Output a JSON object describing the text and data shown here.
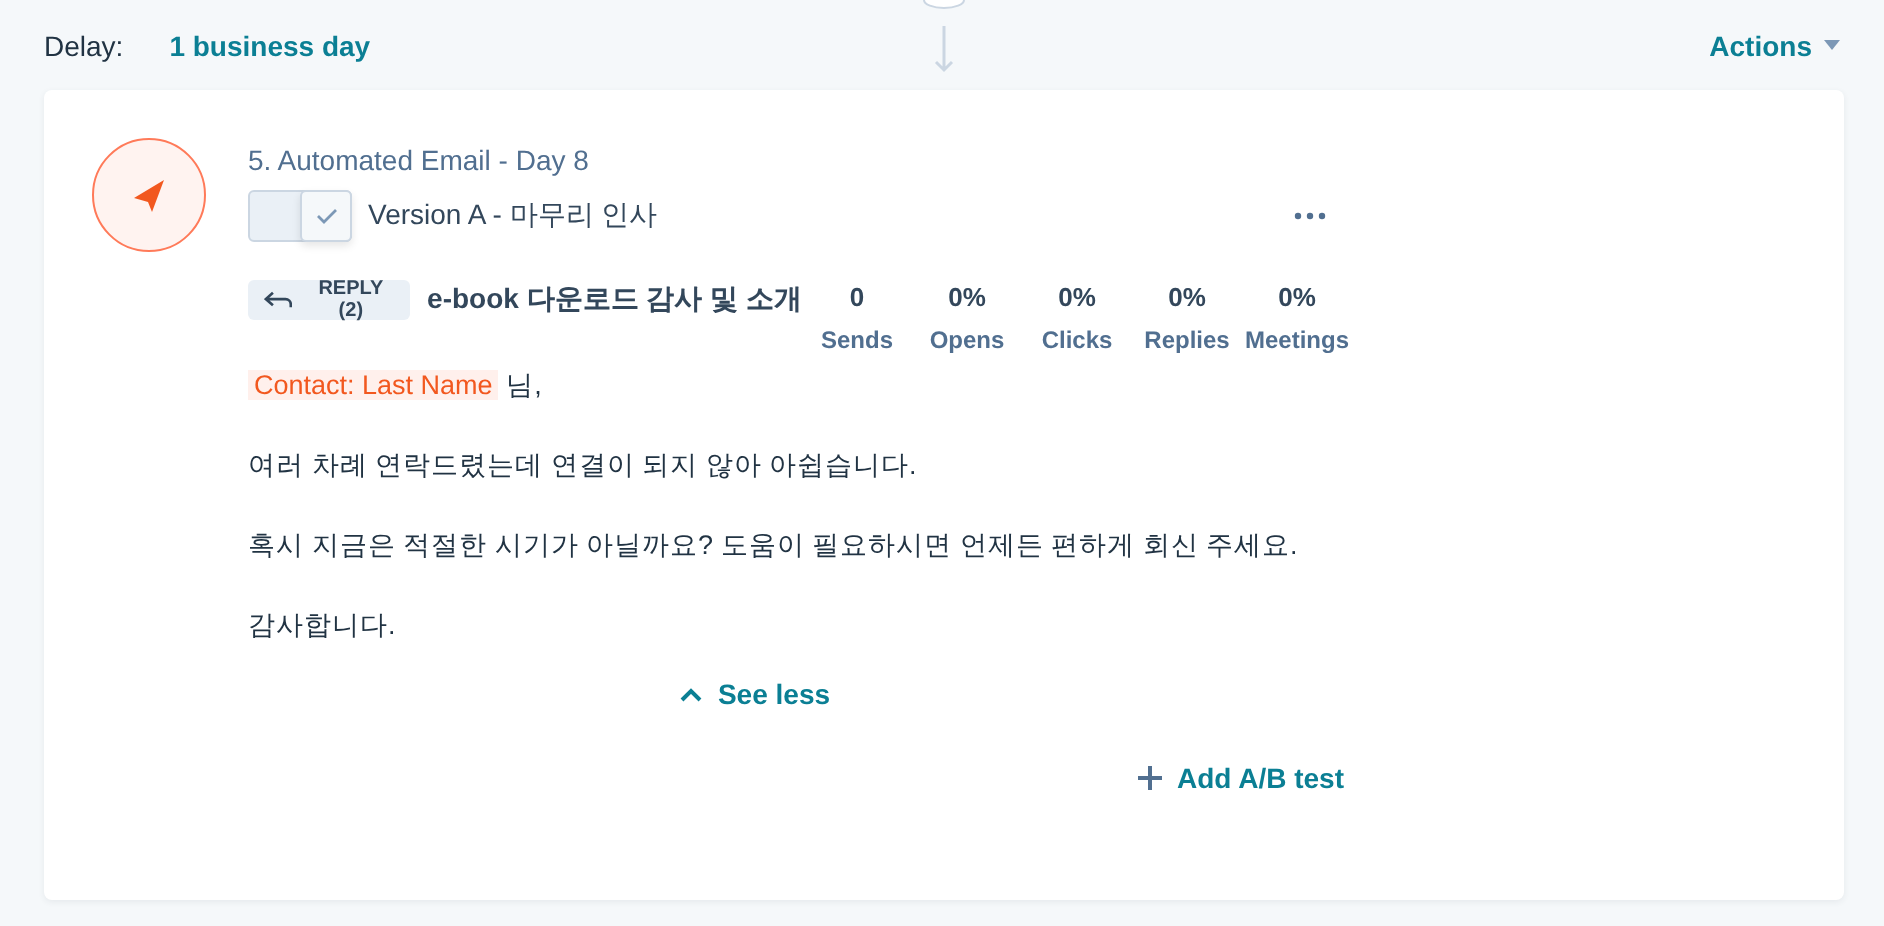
{
  "delay": {
    "label": "Delay:",
    "value": "1 business day"
  },
  "actions": {
    "label": "Actions"
  },
  "step": {
    "title": "5. Automated Email - Day 8",
    "version": {
      "checked": true,
      "label": "Version A - 마무리 인사"
    },
    "reply": {
      "label": "REPLY (2)"
    },
    "subject": "e-book 다운로드 감사 및 소개",
    "stats": [
      {
        "value": "0",
        "label": "Sends"
      },
      {
        "value": "0%",
        "label": "Opens"
      },
      {
        "value": "0%",
        "label": "Clicks"
      },
      {
        "value": "0%",
        "label": "Replies"
      },
      {
        "value": "0%",
        "label": "Meetings"
      }
    ],
    "body": [
      {
        "kind": "token_line",
        "token": "Contact: Last Name",
        "text": "님,"
      },
      {
        "kind": "text",
        "text": "여러 차례 연락드렸는데 연결이 되지 않아 아쉽습니다."
      },
      {
        "kind": "text",
        "text": "혹시 지금은 적절한 시기가 아닐까요? 도움이 필요하시면 언제든 편하게 회신 주세요."
      },
      {
        "kind": "text",
        "text": "감사합니다."
      }
    ],
    "see_less": "See less",
    "add_ab": "Add A/B test"
  }
}
